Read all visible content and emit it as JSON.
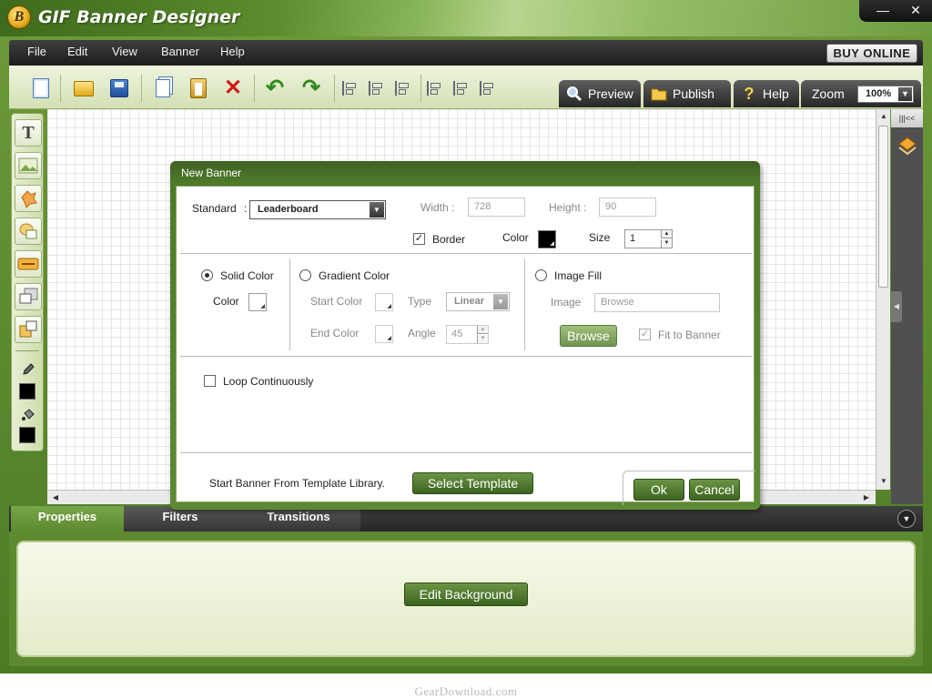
{
  "app": {
    "title": "GIF Banner Designer",
    "logo_letter": "B"
  },
  "window_controls": {
    "minimize": "—",
    "close": "✕"
  },
  "menu": {
    "items": [
      "File",
      "Edit",
      "View",
      "Banner",
      "Help"
    ],
    "buy_label": "BUY ONLINE"
  },
  "toolbar": {
    "icons": [
      "new-file-icon",
      "open-folder-icon",
      "save-icon",
      "copy-icon",
      "paste-icon",
      "delete-icon",
      "undo-icon",
      "redo-icon",
      "align-left-icon",
      "align-center-icon",
      "align-right-icon",
      "align-top-icon",
      "align-middle-icon",
      "align-bottom-icon"
    ],
    "preview_label": "Preview",
    "publish_label": "Publish",
    "help_label": "Help",
    "zoom_label": "Zoom",
    "zoom_value": "100%"
  },
  "left_tools": [
    "text-tool-icon",
    "image-tool-icon",
    "shape-tool-icon",
    "clipart-tool-icon",
    "button-tool-icon",
    "import-tool-icon",
    "export-tool-icon",
    "pencil-icon",
    "fill-bucket-icon"
  ],
  "colors": {
    "accent": "#5c8a2e",
    "dark": "#262626",
    "button_green": "#3c6420"
  },
  "dialog": {
    "title": "New Banner",
    "standard_label": "Standard",
    "colon": ":",
    "standard_value": "Leaderboard",
    "width_label": "Width :",
    "width_value": "728",
    "height_label": "Height :",
    "height_value": "90",
    "border_label": "Border",
    "border_checked_mark": "✓",
    "color_label": "Color",
    "size_label": "Size",
    "size_value": "1",
    "solid_color_label": "Solid Color",
    "solid_color_sub_label": "Color",
    "gradient_color_label": "Gradient Color",
    "start_color_label": "Start Color",
    "type_label": "Type",
    "type_value": "Linear",
    "end_color_label": "End Color",
    "angle_label": "Angle",
    "angle_value": "45",
    "image_fill_label": "Image Fill",
    "image_label": "Image",
    "image_placeholder": "Browse",
    "browse_button": "Browse",
    "fit_to_banner_label": "Fit to Banner",
    "fit_checked_mark": "✓",
    "loop_label": "Loop Continuously",
    "template_text": "Start Banner From Template Library.",
    "select_template_button": "Select Template",
    "ok_button": "Ok",
    "cancel_button": "Cancel"
  },
  "bottom": {
    "tabs": [
      "Properties",
      "Filters",
      "Transitions"
    ],
    "edit_background_button": "Edit Background"
  },
  "watermark": "GearDownload.com"
}
